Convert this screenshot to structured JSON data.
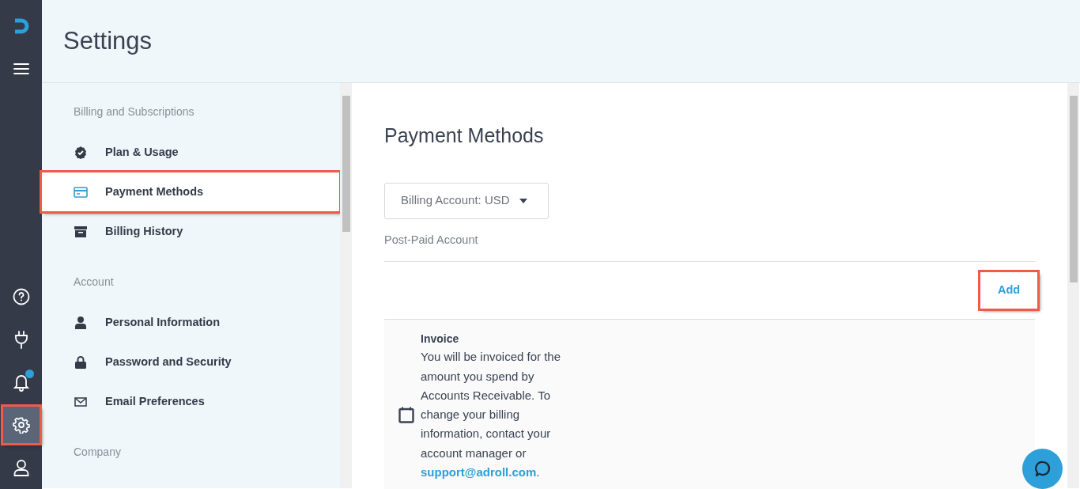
{
  "rail": [
    {
      "kind": "logo",
      "selected": false,
      "highlighted": false
    },
    {
      "kind": "menu",
      "selected": false,
      "highlighted": false
    },
    {
      "kind": "help",
      "selected": false,
      "highlighted": false
    },
    {
      "kind": "plug",
      "selected": false,
      "highlighted": false
    },
    {
      "kind": "bell",
      "selected": false,
      "highlighted": false,
      "badge": true
    },
    {
      "kind": "gear",
      "selected": true,
      "highlighted": true
    },
    {
      "kind": "user",
      "selected": false,
      "highlighted": false
    }
  ],
  "header": {
    "title": "Settings"
  },
  "settings_nav": [
    {
      "heading": "Billing and Subscriptions",
      "items": [
        {
          "kind": "badge",
          "label": "Plan & Usage",
          "selected": false,
          "highlighted": false
        },
        {
          "kind": "card",
          "label": "Payment Methods",
          "selected": true,
          "highlighted": true
        },
        {
          "kind": "archive",
          "label": "Billing History",
          "selected": false,
          "highlighted": false
        }
      ]
    },
    {
      "heading": "Account",
      "items": [
        {
          "kind": "person",
          "label": "Personal Information",
          "selected": false,
          "highlighted": false
        },
        {
          "kind": "lock",
          "label": "Password and Security",
          "selected": false,
          "highlighted": false
        },
        {
          "kind": "mail",
          "label": "Email Preferences",
          "selected": false,
          "highlighted": false
        }
      ]
    },
    {
      "heading": "Company"
    }
  ],
  "content": {
    "title": "Payment Methods",
    "account_dropdown": "Billing Account: USD",
    "account_type": "Post-Paid Account",
    "add_button": {
      "label": "Add",
      "highlighted": true
    },
    "methods": [
      {
        "title": "Invoice",
        "description": "You will be invoiced for the amount you spend by Accounts Receivable. To change your billing information, contact your account manager or",
        "link": "support@adroll.com",
        "suffix": "."
      }
    ]
  }
}
